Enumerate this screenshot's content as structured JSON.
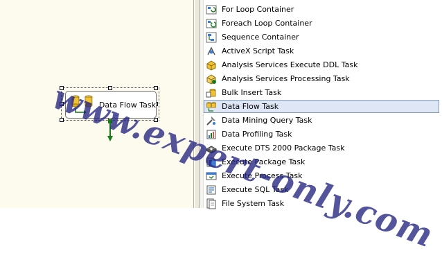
{
  "designer": {
    "task": {
      "label": "Data Flow Task",
      "icon": "data-flow-task-icon"
    }
  },
  "toolbox": {
    "items": [
      {
        "label": "For Loop Container",
        "icon": "for-loop-container-icon",
        "selected": false
      },
      {
        "label": "Foreach Loop Container",
        "icon": "foreach-loop-container-icon",
        "selected": false
      },
      {
        "label": "Sequence Container",
        "icon": "sequence-container-icon",
        "selected": false
      },
      {
        "label": "ActiveX Script Task",
        "icon": "activex-script-task-icon",
        "selected": false
      },
      {
        "label": "Analysis Services Execute DDL Task",
        "icon": "analysis-services-ddl-icon",
        "selected": false
      },
      {
        "label": "Analysis Services Processing Task",
        "icon": "analysis-services-processing-icon",
        "selected": false
      },
      {
        "label": "Bulk Insert Task",
        "icon": "bulk-insert-task-icon",
        "selected": false
      },
      {
        "label": "Data Flow Task",
        "icon": "data-flow-task-icon",
        "selected": true
      },
      {
        "label": "Data Mining Query Task",
        "icon": "data-mining-query-task-icon",
        "selected": false
      },
      {
        "label": "Data Profiling Task",
        "icon": "data-profiling-task-icon",
        "selected": false
      },
      {
        "label": "Execute DTS 2000 Package Task",
        "icon": "execute-dts-2000-package-icon",
        "selected": false
      },
      {
        "label": "Execute Package Task",
        "icon": "execute-package-task-icon",
        "selected": false
      },
      {
        "label": "Execute Process Task",
        "icon": "execute-process-task-icon",
        "selected": false
      },
      {
        "label": "Execute SQL Task",
        "icon": "execute-sql-task-icon",
        "selected": false
      },
      {
        "label": "File System Task",
        "icon": "file-system-task-icon",
        "selected": false
      }
    ]
  },
  "watermark": {
    "text": "www.expert-only.com"
  },
  "colors": {
    "designer_bg": "#fcfbee",
    "selection_bg": "#dfe6f6",
    "selection_border": "#7f9db9",
    "connector_green": "#1a7a1a",
    "watermark": "#242480"
  }
}
